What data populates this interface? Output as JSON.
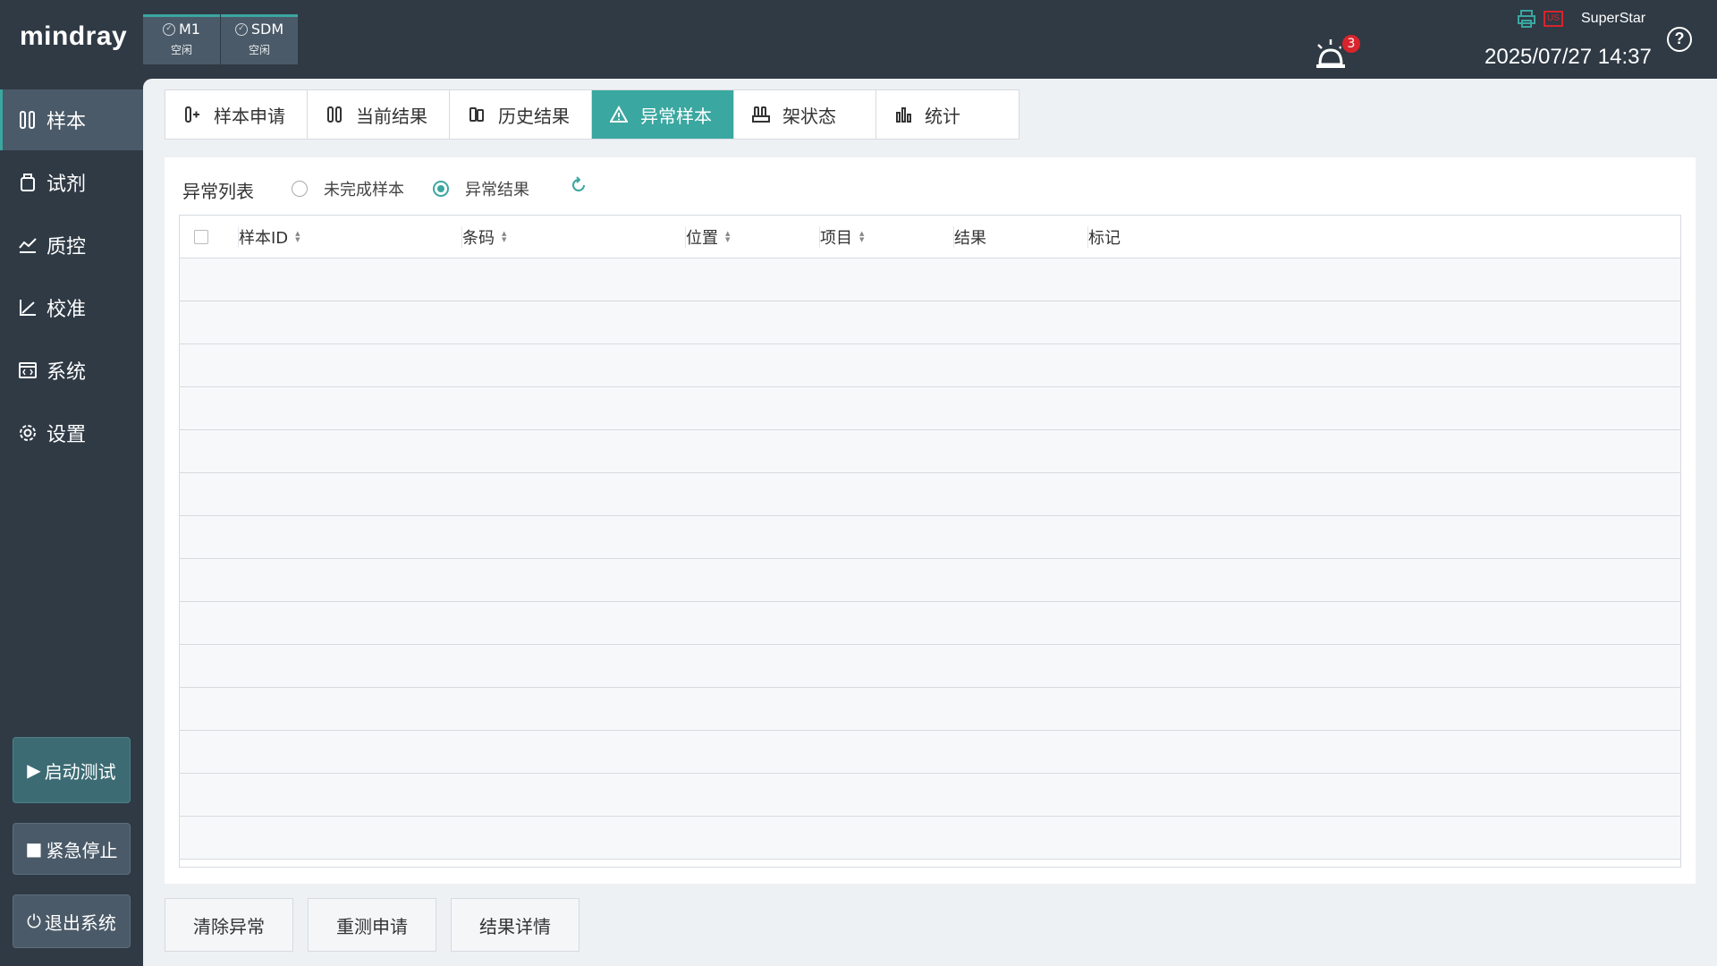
{
  "brand": "mindray",
  "modules": [
    {
      "name": "M1",
      "status": "空闲"
    },
    {
      "name": "SDM",
      "status": "空闲"
    }
  ],
  "header": {
    "alarm_count": "3",
    "usb_label": "US",
    "user": "SuperStar",
    "datetime": "2025/07/27 14:37",
    "help_label": "?"
  },
  "sidebar": {
    "items": [
      {
        "label": "样本",
        "icon": "tubes-icon"
      },
      {
        "label": "试剂",
        "icon": "reagent-bottle-icon"
      },
      {
        "label": "质控",
        "icon": "qc-chart-icon"
      },
      {
        "label": "校准",
        "icon": "calibration-chart-icon"
      },
      {
        "label": "系统",
        "icon": "system-code-icon"
      },
      {
        "label": "设置",
        "icon": "gear-icon"
      }
    ],
    "start_test": "启动测试",
    "emergency_stop": "紧急停止",
    "exit": "退出系统"
  },
  "tabs": [
    {
      "label": "样本申请",
      "icon": "sample-add-icon"
    },
    {
      "label": "当前结果",
      "icon": "tubes-icon"
    },
    {
      "label": "历史结果",
      "icon": "history-icon"
    },
    {
      "label": "异常样本",
      "icon": "warning-icon"
    },
    {
      "label": "架状态",
      "icon": "rack-icon"
    },
    {
      "label": "统计",
      "icon": "bar-chart-icon"
    }
  ],
  "active_tab": "异常样本",
  "panel": {
    "title": "异常列表",
    "radio_options": [
      "未完成样本",
      "异常结果"
    ],
    "selected_option": "异常结果"
  },
  "table": {
    "columns": [
      "样本ID",
      "条码",
      "位置",
      "项目",
      "结果",
      "标记"
    ],
    "rows": []
  },
  "actions": [
    "清除异常",
    "重测申请",
    "结果详情"
  ],
  "colors": {
    "accent": "#3aa7a0",
    "chrome": "#2f3a45",
    "alarm": "#d8242c"
  }
}
